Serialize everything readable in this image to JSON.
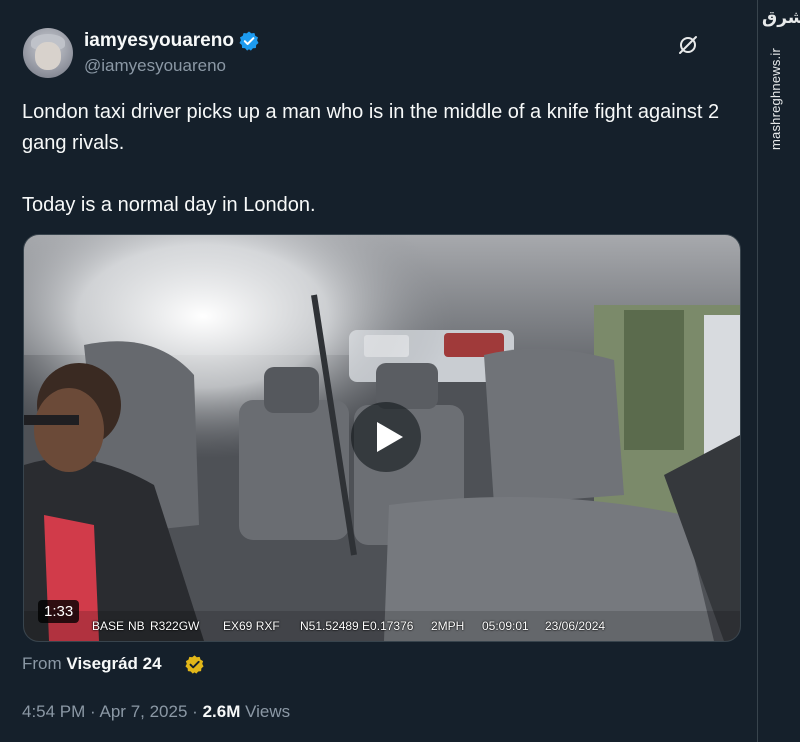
{
  "author": {
    "display_name": "iamyesyouareno",
    "handle": "@iamyesyouareno",
    "verified_color": "#1d9bf0"
  },
  "tweet": {
    "line1": "London taxi driver picks up a man who is in the middle of a knife fight against 2 gang rivals.",
    "line2": "Today is a normal day in London."
  },
  "video": {
    "duration": "1:33",
    "overlay": {
      "base": "BASE",
      "camera_id": "NB",
      "plate_ref": "R322GW",
      "reg": "EX69 RXF",
      "coords": "N51.52489 E0.17376",
      "speed": "2MPH",
      "time": "05:09:01",
      "date": "23/06/2024"
    }
  },
  "source": {
    "prefix": "From",
    "name": "Visegrád 24",
    "badge_color": "#e2b719"
  },
  "meta": {
    "time": "4:54 PM",
    "sep1": "·",
    "date": "Apr 7, 2025",
    "sep2": "·",
    "views_count": "2.6M",
    "views_label": "Views"
  },
  "watermark": {
    "logo": "مشرق",
    "site": "mashreghnews.ir"
  },
  "icons": {
    "verified": "verified-check-icon",
    "grok": "grok-icon",
    "play": "play-icon"
  }
}
